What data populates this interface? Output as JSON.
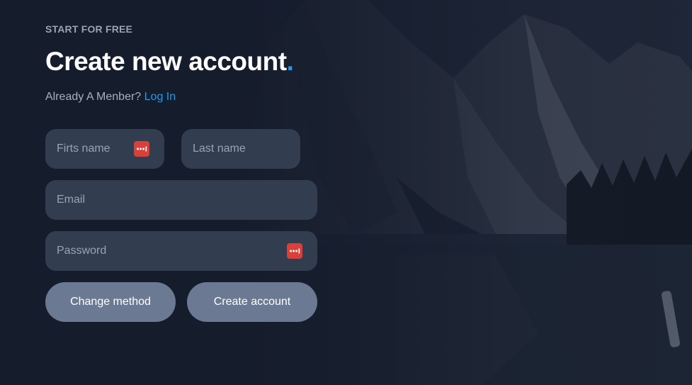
{
  "header": {
    "eyebrow": "START FOR FREE",
    "title": "Create new account",
    "title_dot": ".",
    "member_prompt": "Already A Menber?",
    "login_link": "Log In"
  },
  "form": {
    "first_name": {
      "placeholder": "Firts name",
      "value": ""
    },
    "last_name": {
      "placeholder": "Last name",
      "value": ""
    },
    "email": {
      "placeholder": "Email",
      "value": ""
    },
    "password": {
      "placeholder": "Password",
      "value": ""
    }
  },
  "actions": {
    "change_method": "Change method",
    "create_account": "Create account"
  },
  "icons": {
    "password_manager": "password-manager-icon",
    "background": "mountain-lake-image"
  },
  "colors": {
    "accent": "#1d9bf0",
    "background": "#151c2c",
    "field": "#323d4f",
    "button": "#6b7a92",
    "password_manager_icon": "#d8403b"
  }
}
